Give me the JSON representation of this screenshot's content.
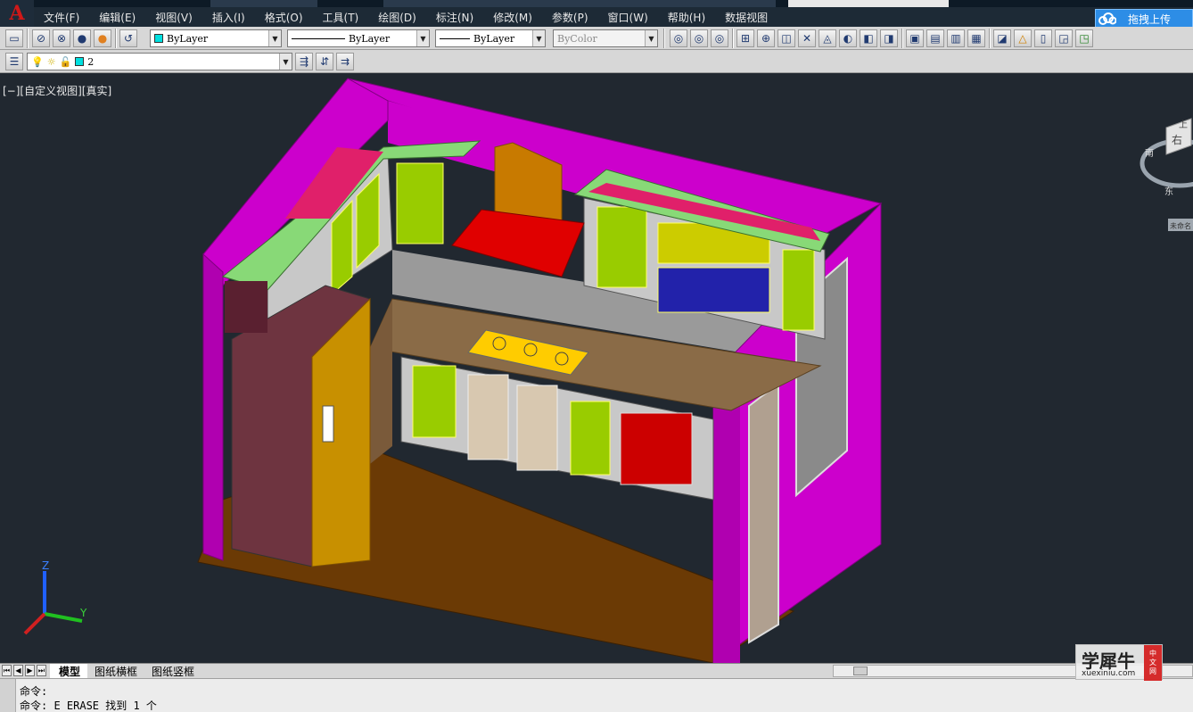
{
  "menu": {
    "items": [
      "文件(F)",
      "编辑(E)",
      "视图(V)",
      "插入(I)",
      "格式(O)",
      "工具(T)",
      "绘图(D)",
      "标注(N)",
      "修改(M)",
      "参数(P)",
      "窗口(W)",
      "帮助(H)",
      "数据视图"
    ],
    "upload_label": "拖拽上传"
  },
  "toolbar1": {
    "color_value": "ByLayer",
    "linetype_value": "ByLayer",
    "lineweight_value": "ByLayer",
    "plotstyle_value": "ByColor",
    "swatch_color": "#00e0e0"
  },
  "toolbar2": {
    "layer_value": "2"
  },
  "viewport": {
    "label": "[−][自定义视图][真实]",
    "viewcube_top": "上",
    "viewcube_right": "右",
    "viewcube_north": "南",
    "viewcube_east": "东",
    "ucs_z": "Z",
    "ucs_y": "Y",
    "ucs_wcs": "未命名"
  },
  "tabs": {
    "model": "模型",
    "layout1": "图纸横框",
    "layout2": "图纸竖框"
  },
  "command": {
    "line1": "命令:",
    "line2": "命令: E ERASE 找到 1 个"
  },
  "watermark": {
    "name": "学犀牛",
    "url": "xuexiniu.com",
    "badge": [
      "中",
      "文",
      "网"
    ]
  },
  "colors": {
    "wall_magenta": "#cc00cc",
    "cabinet_green": "#99cc00",
    "trim_green": "#88d977",
    "floor_brown": "#6b3a05",
    "counter_tan": "#8a6b47",
    "fridge_maroon": "#6e3440",
    "hood_red": "#e00000",
    "viewport_bg": "#212830"
  }
}
